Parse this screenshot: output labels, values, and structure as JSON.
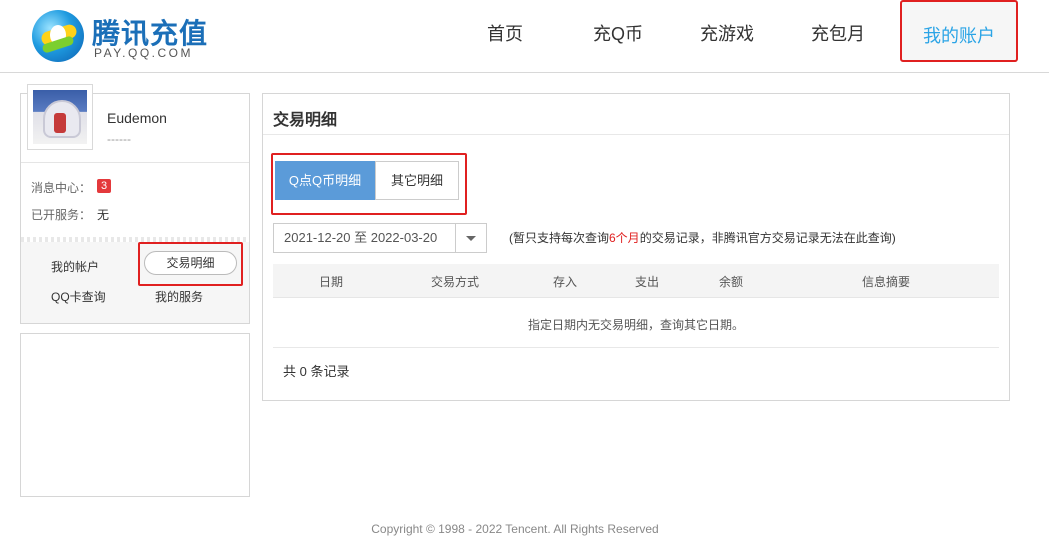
{
  "logo": {
    "title": "腾讯充值",
    "sub": "PAY.QQ.COM"
  },
  "nav": {
    "items": [
      "首页",
      "充Q币",
      "充游戏",
      "充包月"
    ],
    "active": "我的账户"
  },
  "user": {
    "name": "Eudemon",
    "sub": "------"
  },
  "side": {
    "msg_label": "消息中心：",
    "msg_count": "3",
    "svc_label": "已开服务：",
    "svc_value": "无",
    "links": {
      "account": "我的帐户",
      "detail": "交易明细",
      "qqcard": "QQ卡查询",
      "services": "我的服务"
    }
  },
  "main": {
    "title": "交易明细",
    "tabs": [
      "Q点Q币明细",
      "其它明细"
    ],
    "date_range": "2021-12-20 至 2022-03-20",
    "note_pre": "(暂只支持每次查询",
    "note_hl": "6个月",
    "note_post": "的交易记录，非腾讯官方交易记录无法在此查询)",
    "columns": [
      "日期",
      "交易方式",
      "存入",
      "支出",
      "余额",
      "信息摘要"
    ],
    "empty_text": "指定日期内无交易明细，查询其它日期。",
    "total": "共 0 条记录"
  },
  "footer": "Copyright © 1998 - 2022 Tencent. All Rights Reserved",
  "colors": {
    "accent": "#2ba4e6",
    "tab_active": "#5b9bd9",
    "highlight": "#e02020"
  }
}
